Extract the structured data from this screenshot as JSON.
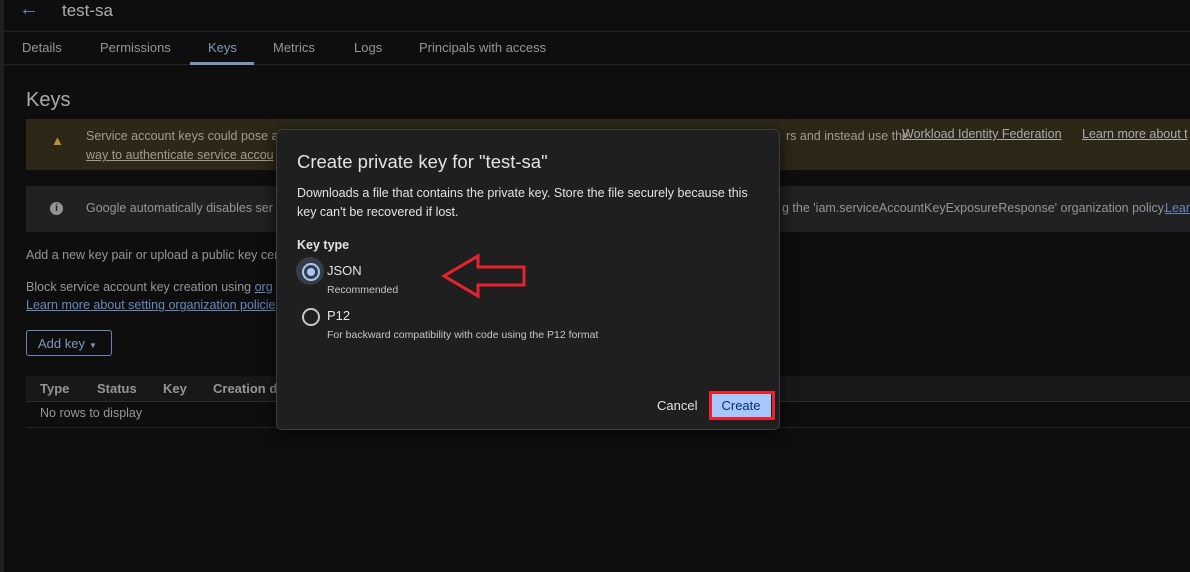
{
  "header": {
    "back_icon": "arrow-left-icon",
    "title": "test-sa"
  },
  "tabs": [
    {
      "label": "Details"
    },
    {
      "label": "Permissions"
    },
    {
      "label": "Keys",
      "active": true
    },
    {
      "label": "Metrics"
    },
    {
      "label": "Logs"
    },
    {
      "label": "Principals with access"
    }
  ],
  "main": {
    "title": "Keys",
    "warning": {
      "icon": "warning-icon",
      "line1_start": "Service account keys could pose a",
      "line1_end": "rs and instead use the",
      "line1_link": "Workload Identity Federation",
      "line1_link2": "Learn more about t",
      "line2_start": "way to authenticate service accou"
    },
    "info": {
      "icon": "info-icon",
      "text_start": "Google automatically disables ser",
      "text_end": "g the 'iam.serviceAccountKeyExposureResponse' organization policy.",
      "link": "Lear"
    },
    "add_pair_text": "Add a new key pair or upload a public key cer",
    "block_text": "Block service account key creation using",
    "block_link": "org",
    "learn_link": "Learn more about setting organization policie",
    "add_key_label": "Add key",
    "table": {
      "columns": [
        "Type",
        "Status",
        "Key",
        "Creation d"
      ],
      "empty": "No rows to display"
    }
  },
  "dialog": {
    "title": "Create private key for \"test-sa\"",
    "description": "Downloads a file that contains the private key. Store the file securely because this key can't be recovered if lost.",
    "key_type_label": "Key type",
    "options": [
      {
        "label": "JSON",
        "sub": "Recommended",
        "selected": true
      },
      {
        "label": "P12",
        "sub": "For backward compatibility with code using the P12 format",
        "selected": false
      }
    ],
    "cancel_label": "Cancel",
    "create_label": "Create"
  },
  "annotations": {
    "arrow_color": "#e8232f",
    "highlight_color": "#e8232f"
  }
}
